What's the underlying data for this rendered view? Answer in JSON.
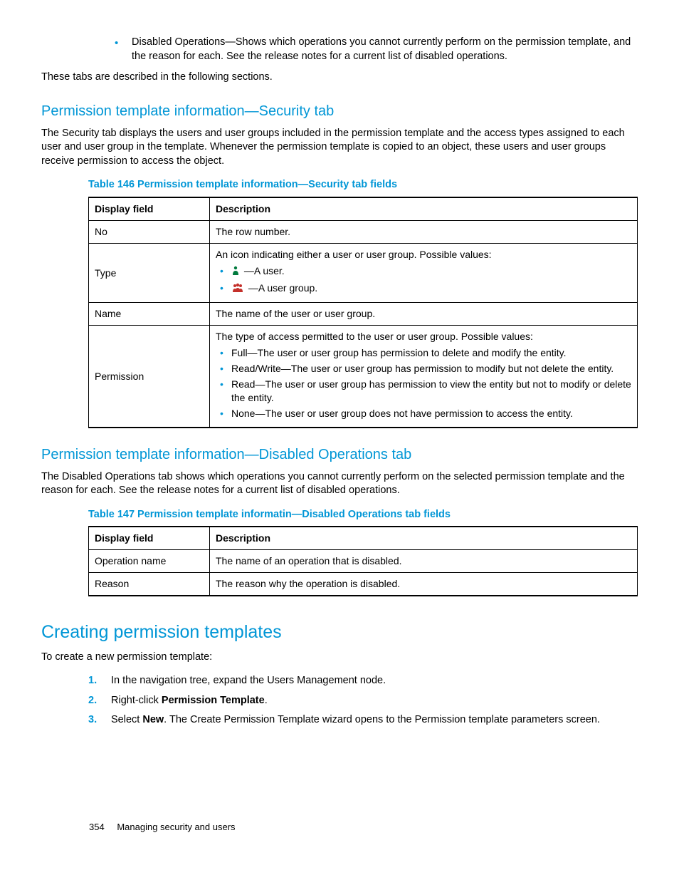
{
  "intro_bullet": "Disabled Operations—Shows which operations you cannot currently perform on the permission template, and the reason for each. See the release notes for a current list of disabled operations.",
  "intro_following": "These tabs are described in the following sections.",
  "sec1": {
    "heading": "Permission template information—Security tab",
    "para": "The Security tab displays the users and user groups included in the permission template and the access types assigned to each user and user group in the template. Whenever the permission template is copied to an object, these users and user groups receive permission to access the object.",
    "table_caption": "Table 146 Permission template information—Security tab fields",
    "col1": "Display field",
    "col2": "Description",
    "rows": {
      "r0": {
        "field": "No",
        "desc": "The row number."
      },
      "r1": {
        "field": "Type",
        "intro": "An icon indicating either a user or user group. Possible values:",
        "b0": "—A user.",
        "b1": "—A user group."
      },
      "r2": {
        "field": "Name",
        "desc": "The name of the user or user group."
      },
      "r3": {
        "field": "Permission",
        "intro": "The type of access permitted to the user or user group. Possible values:",
        "b0": "Full—The user or user group has permission to delete and modify the entity.",
        "b1": "Read/Write—The user or user group has permission to modify but not delete the entity.",
        "b2": "Read—The user or user group has permission to view the entity but not to modify or delete the entity.",
        "b3": "None—The user or user group does not have permission to access the entity."
      }
    }
  },
  "sec2": {
    "heading": "Permission template information—Disabled Operations tab",
    "para": "The Disabled Operations tab shows which operations you cannot currently perform on the selected permission template and the reason for each. See the release notes for a current list of disabled operations.",
    "table_caption": "Table 147 Permission template informatin—Disabled Operations tab fields",
    "col1": "Display field",
    "col2": "Description",
    "rows": {
      "r0": {
        "field": "Operation name",
        "desc": "The name of an operation that is disabled."
      },
      "r1": {
        "field": "Reason",
        "desc": "The reason why the operation is disabled."
      }
    }
  },
  "sec3": {
    "heading": "Creating permission templates",
    "para": "To create a new permission template:",
    "steps": {
      "s0": {
        "num": "1.",
        "pre": "In the navigation tree, expand the Users Management node."
      },
      "s1": {
        "num": "2.",
        "pre": "Right-click ",
        "bold": "Permission Template",
        "post": "."
      },
      "s2": {
        "num": "3.",
        "pre": "Select ",
        "bold": "New",
        "post": ". The Create Permission Template wizard opens to the Permission template parameters screen."
      }
    }
  },
  "footer": {
    "page": "354",
    "title": "Managing security and users"
  }
}
